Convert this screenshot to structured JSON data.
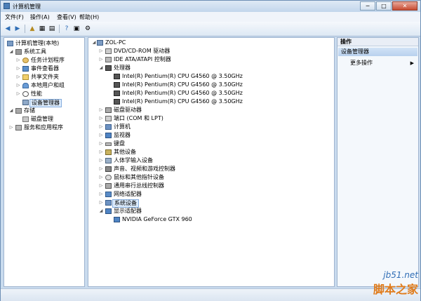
{
  "window": {
    "title": "计算机管理",
    "btn_min": "─",
    "btn_max": "□",
    "btn_close": "✕"
  },
  "menu": [
    "文件(F)",
    "操作(A)",
    "查看(V)",
    "帮助(H)"
  ],
  "left_tree": [
    {
      "label": "计算机管理(本地)",
      "depth": 0,
      "expander": "",
      "icon": "computer-mgmt-icon"
    },
    {
      "label": "系统工具",
      "depth": 1,
      "expander": "◢",
      "icon": "tools-icon"
    },
    {
      "label": "任务计划程序",
      "depth": 2,
      "expander": "▷",
      "icon": "clock-icon"
    },
    {
      "label": "事件查看器",
      "depth": 2,
      "expander": "▷",
      "icon": "event-viewer-icon"
    },
    {
      "label": "共享文件夹",
      "depth": 2,
      "expander": "▷",
      "icon": "shared-folder-icon"
    },
    {
      "label": "本地用户和组",
      "depth": 2,
      "expander": "▷",
      "icon": "users-icon"
    },
    {
      "label": "性能",
      "depth": 2,
      "expander": "▷",
      "icon": "performance-icon"
    },
    {
      "label": "设备管理器",
      "depth": 2,
      "expander": "",
      "icon": "device-manager-icon",
      "selected": true
    },
    {
      "label": "存储",
      "depth": 1,
      "expander": "◢",
      "icon": "storage-icon"
    },
    {
      "label": "磁盘管理",
      "depth": 2,
      "expander": "",
      "icon": "disk-icon"
    },
    {
      "label": "服务和应用程序",
      "depth": 1,
      "expander": "▷",
      "icon": "services-icon"
    }
  ],
  "device_tree": [
    {
      "label": "ZOL-PC",
      "depth": 0,
      "expander": "◢",
      "icon": "computer-icon"
    },
    {
      "label": "DVD/CD-ROM 驱动器",
      "depth": 1,
      "expander": "▷",
      "icon": "dvd-icon"
    },
    {
      "label": "IDE ATA/ATAPI 控制器",
      "depth": 1,
      "expander": "▷",
      "icon": "ide-icon"
    },
    {
      "label": "处理器",
      "depth": 1,
      "expander": "◢",
      "icon": "processor-icon"
    },
    {
      "label": "Intel(R) Pentium(R) CPU G4560 @ 3.50GHz",
      "depth": 2,
      "expander": "",
      "icon": "cpu-icon"
    },
    {
      "label": "Intel(R) Pentium(R) CPU G4560 @ 3.50GHz",
      "depth": 2,
      "expander": "",
      "icon": "cpu-icon"
    },
    {
      "label": "Intel(R) Pentium(R) CPU G4560 @ 3.50GHz",
      "depth": 2,
      "expander": "",
      "icon": "cpu-icon"
    },
    {
      "label": "Intel(R) Pentium(R) CPU G4560 @ 3.50GHz",
      "depth": 2,
      "expander": "",
      "icon": "cpu-icon"
    },
    {
      "label": "磁盘驱动器",
      "depth": 1,
      "expander": "▷",
      "icon": "disk-drive-icon"
    },
    {
      "label": "端口 (COM 和 LPT)",
      "depth": 1,
      "expander": "▷",
      "icon": "port-icon"
    },
    {
      "label": "计算机",
      "depth": 1,
      "expander": "▷",
      "icon": "computer-icon"
    },
    {
      "label": "监视器",
      "depth": 1,
      "expander": "▷",
      "icon": "monitor-icon"
    },
    {
      "label": "键盘",
      "depth": 1,
      "expander": "▷",
      "icon": "keyboard-icon"
    },
    {
      "label": "其他设备",
      "depth": 1,
      "expander": "▷",
      "icon": "other-device-icon"
    },
    {
      "label": "人体学输入设备",
      "depth": 1,
      "expander": "▷",
      "icon": "hid-icon"
    },
    {
      "label": "声音、视频和游戏控制器",
      "depth": 1,
      "expander": "▷",
      "icon": "sound-icon"
    },
    {
      "label": "鼠标和其他指针设备",
      "depth": 1,
      "expander": "▷",
      "icon": "mouse-icon"
    },
    {
      "label": "通用串行总线控制器",
      "depth": 1,
      "expander": "▷",
      "icon": "usb-icon"
    },
    {
      "label": "网络适配器",
      "depth": 1,
      "expander": "▷",
      "icon": "network-icon"
    },
    {
      "label": "系统设备",
      "depth": 1,
      "expander": "▷",
      "icon": "system-device-icon",
      "selected": true
    },
    {
      "label": "显示适配器",
      "depth": 1,
      "expander": "◢",
      "icon": "display-adapter-icon"
    },
    {
      "label": "NVIDIA GeForce GTX 960",
      "depth": 2,
      "expander": "",
      "icon": "gpu-icon"
    }
  ],
  "actions": {
    "header": "操作",
    "section": "设备管理器",
    "more": "更多操作",
    "arrow": "▶"
  },
  "watermark": {
    "url": "jb51.net",
    "text": "脚本之家"
  }
}
